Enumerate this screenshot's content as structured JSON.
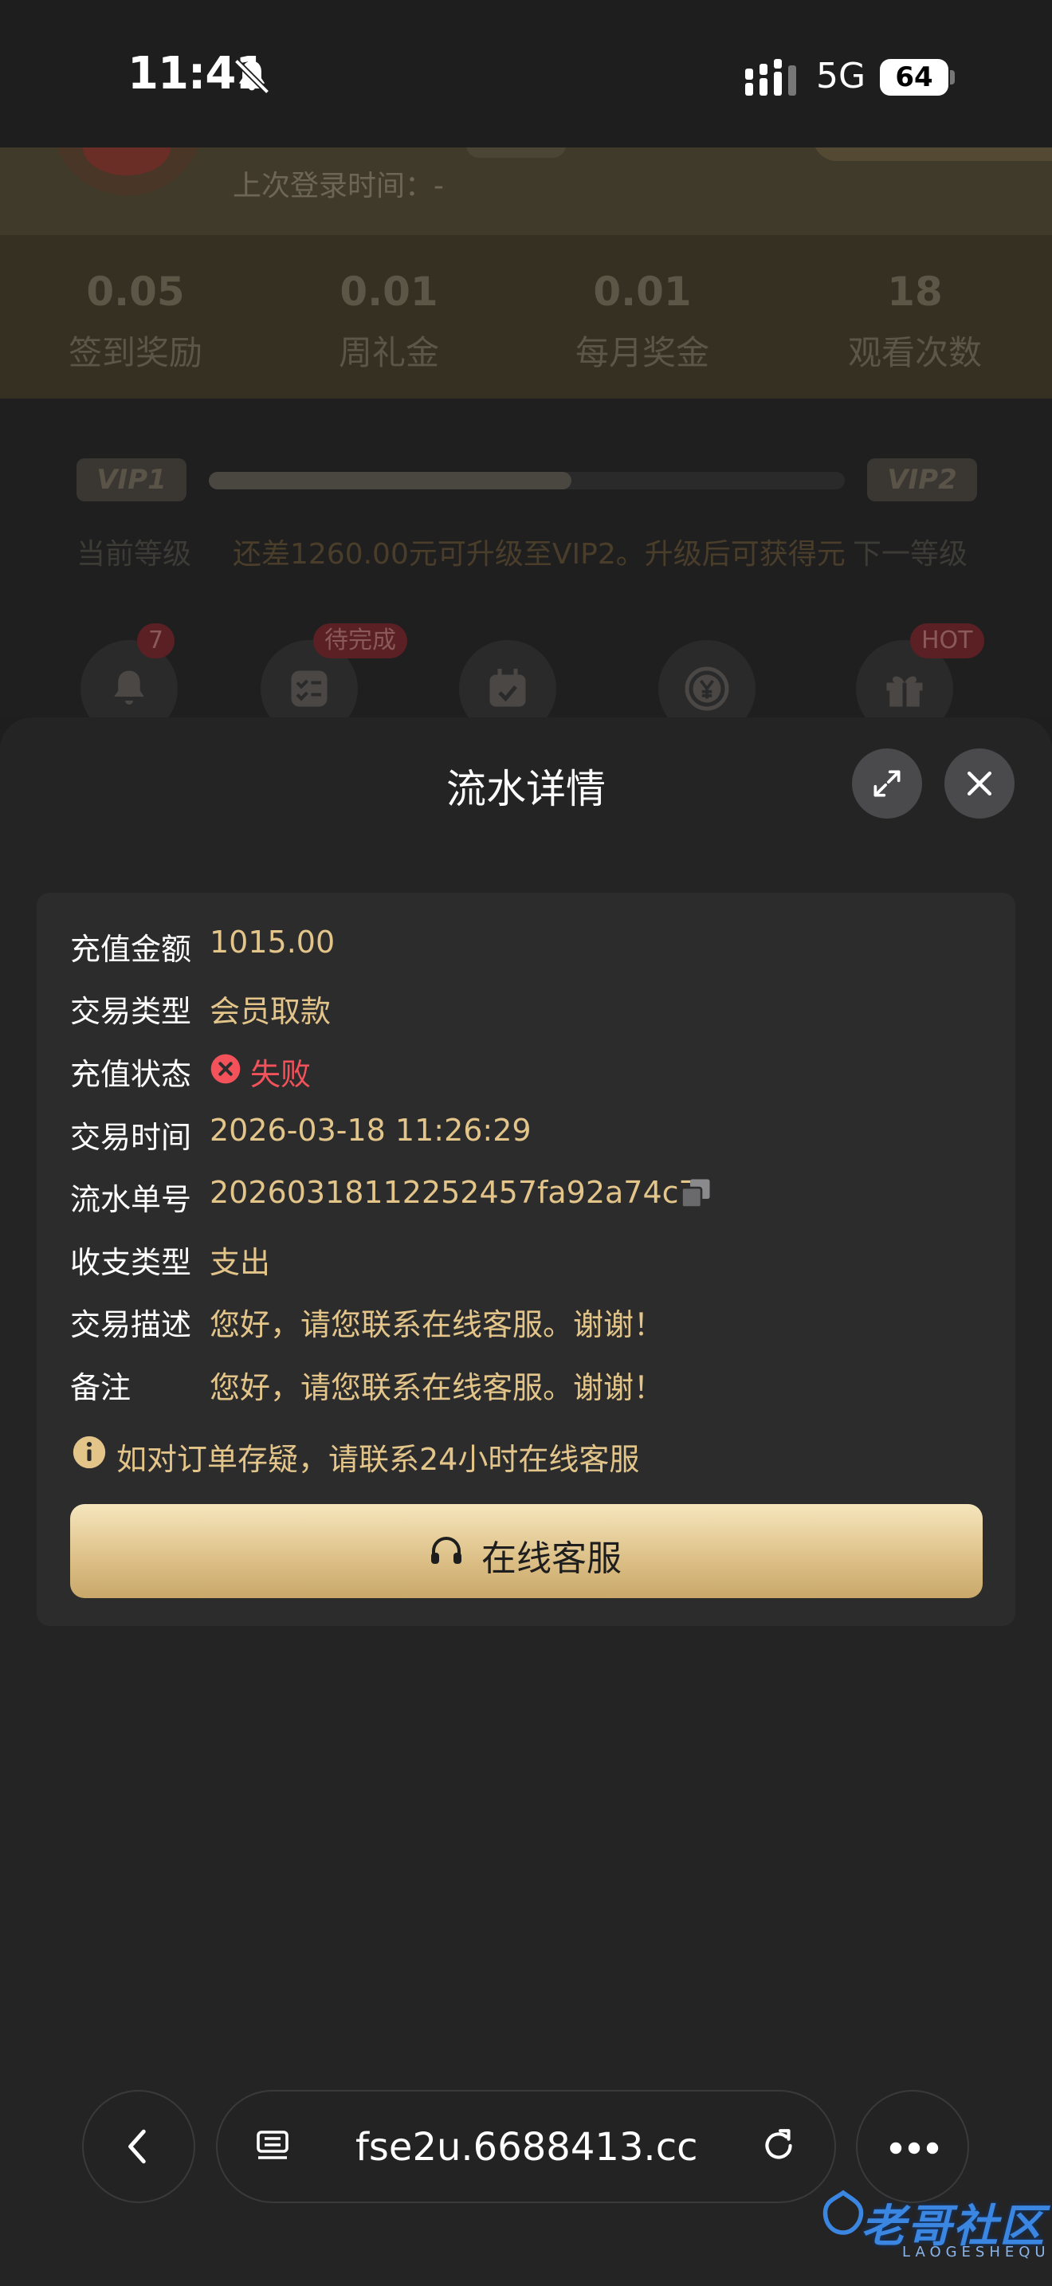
{
  "status_bar": {
    "time": "11:41",
    "network": "5G",
    "battery": "64"
  },
  "background": {
    "last_login_label": "上次登录时间：-",
    "stats": [
      {
        "value": "0.05",
        "label": "签到奖励"
      },
      {
        "value": "0.01",
        "label": "周礼金"
      },
      {
        "value": "0.01",
        "label": "每月奖金"
      },
      {
        "value": "18",
        "label": "观看次数"
      }
    ],
    "vip": {
      "current_badge": "VIP1",
      "next_badge": "VIP2",
      "current_label": "当前等级",
      "next_label": "下一等级",
      "progress_fraction": 0.57,
      "message": "还差1260.00元可升级至VIP2。升级后可获得元"
    },
    "quick_icons": [
      {
        "icon": "bell-icon",
        "badge": "7"
      },
      {
        "icon": "checklist-icon",
        "badge": "待完成"
      },
      {
        "icon": "calendar-icon",
        "badge": ""
      },
      {
        "icon": "yen-coin-icon",
        "badge": ""
      },
      {
        "icon": "gift-icon",
        "badge": "HOT"
      }
    ]
  },
  "sheet": {
    "title": "流水详情",
    "rows": [
      {
        "label": "充值金额",
        "value": "1015.00"
      },
      {
        "label": "交易类型",
        "value": "会员取款"
      },
      {
        "label": "充值状态",
        "value": "失败"
      },
      {
        "label": "交易时间",
        "value": "2026-03-18 11:26:29"
      },
      {
        "label": "流水单号",
        "value": "20260318112252457fa92a74c7"
      },
      {
        "label": "收支类型",
        "value": "支出"
      },
      {
        "label": "交易描述",
        "value": "您好，请您联系在线客服。谢谢！"
      },
      {
        "label": "备注",
        "value": "您好，请您联系在线客服。谢谢！"
      }
    ],
    "notice": "如对订单存疑，请联系24小时在线客服",
    "cs_button_label": "在线客服"
  },
  "browser": {
    "url": "fse2u.6688413.cc"
  },
  "watermark": {
    "text": "老哥社区",
    "sub": "LAOGESHEQU"
  },
  "colors": {
    "accent_gold": "#e3c58a",
    "fail_red": "#f4525a",
    "sheet_bg": "#242425"
  }
}
